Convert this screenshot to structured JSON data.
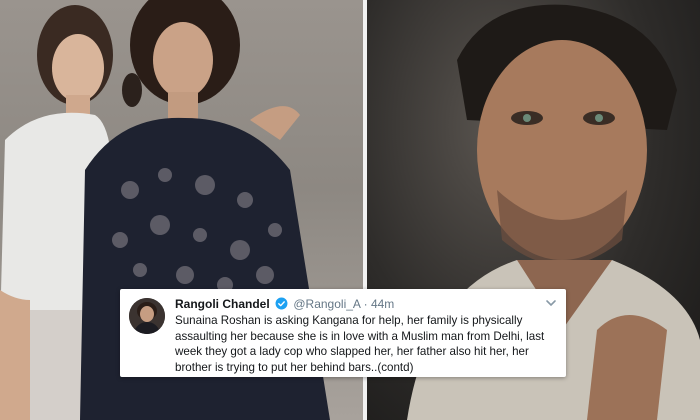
{
  "tweet": {
    "display_name": "Rangoli Chandel",
    "handle": "@Rangoli_A",
    "separator": "·",
    "time": "44m",
    "text": "Sunaina Roshan is asking Kangana for help, her family is physically assaulting her because she is in love with a Muslim man from Delhi, last week they got a lady cop who slapped her, her father also hit her, her brother is trying to put her behind bars..(contd)"
  },
  "icons": {
    "verified": "verified-badge-icon",
    "caret": "chevron-down-icon",
    "verified_color": "#1da1f2"
  }
}
